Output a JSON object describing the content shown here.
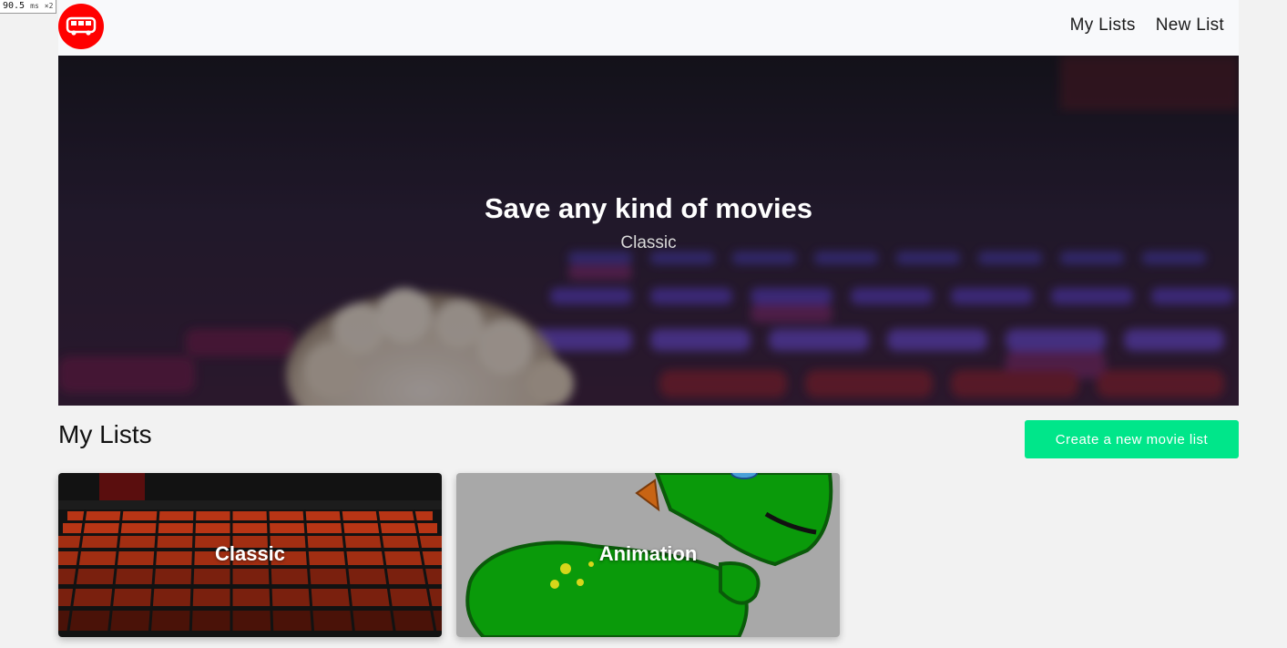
{
  "perf_meter": {
    "value": "90.5",
    "unit": "ms",
    "multiplier": "×2"
  },
  "navbar": {
    "logo_icon": "bus-icon",
    "logo_color": "#ff0000",
    "links": [
      "My Lists",
      "New List"
    ]
  },
  "hero": {
    "title": "Save any kind of movies",
    "subtitle": "Classic"
  },
  "lists_section": {
    "title": "My Lists",
    "create_button": "Create a new movie list",
    "button_color": "#00e68a",
    "cards": [
      {
        "label": "Classic"
      },
      {
        "label": "Animation"
      }
    ]
  }
}
